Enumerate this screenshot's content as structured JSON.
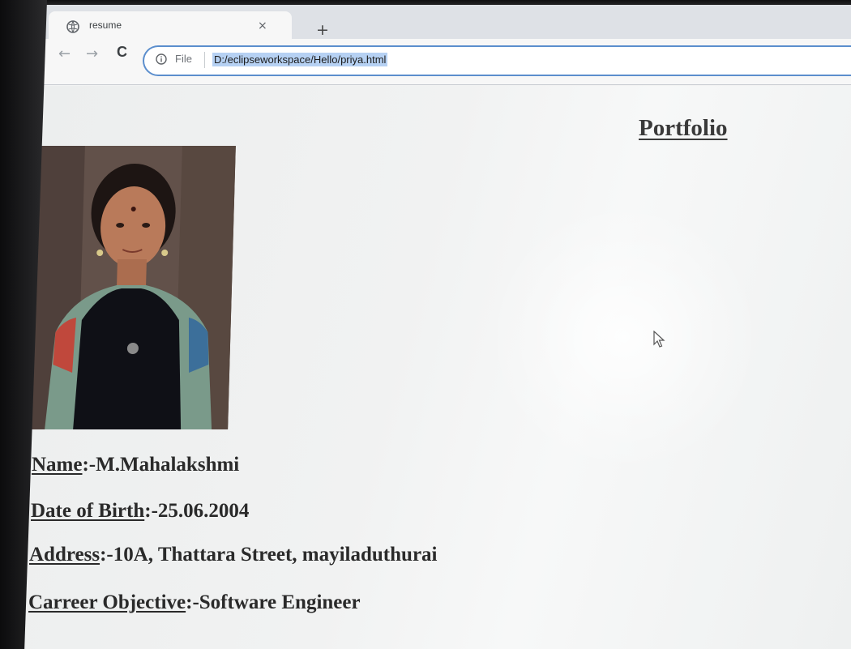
{
  "browser": {
    "tab_title": "resume",
    "close_symbol": "×",
    "new_tab_symbol": "+",
    "back_symbol": "←",
    "forward_symbol": "→",
    "reload_symbol": "C",
    "file_label": "File",
    "url": "D:/eclipseworkspace/Hello/priya.html"
  },
  "page": {
    "heading": "Portfolio",
    "fields": [
      {
        "key": "Name",
        "sep": ":-",
        "value": "M.Mahalakshmi"
      },
      {
        "key": "Date of Birth",
        "sep": ":-",
        "value": "25.06.2004"
      },
      {
        "key": "Address",
        "sep": ":-",
        "value": "10A, Thattara Street, mayiladuthurai"
      },
      {
        "key": "Carreer Objective",
        "sep": ":-",
        "value": "Software Engineer"
      }
    ]
  },
  "icons": {
    "favicon": "globe-icon",
    "info": "info-icon",
    "cursor": "mouse-pointer-icon"
  }
}
